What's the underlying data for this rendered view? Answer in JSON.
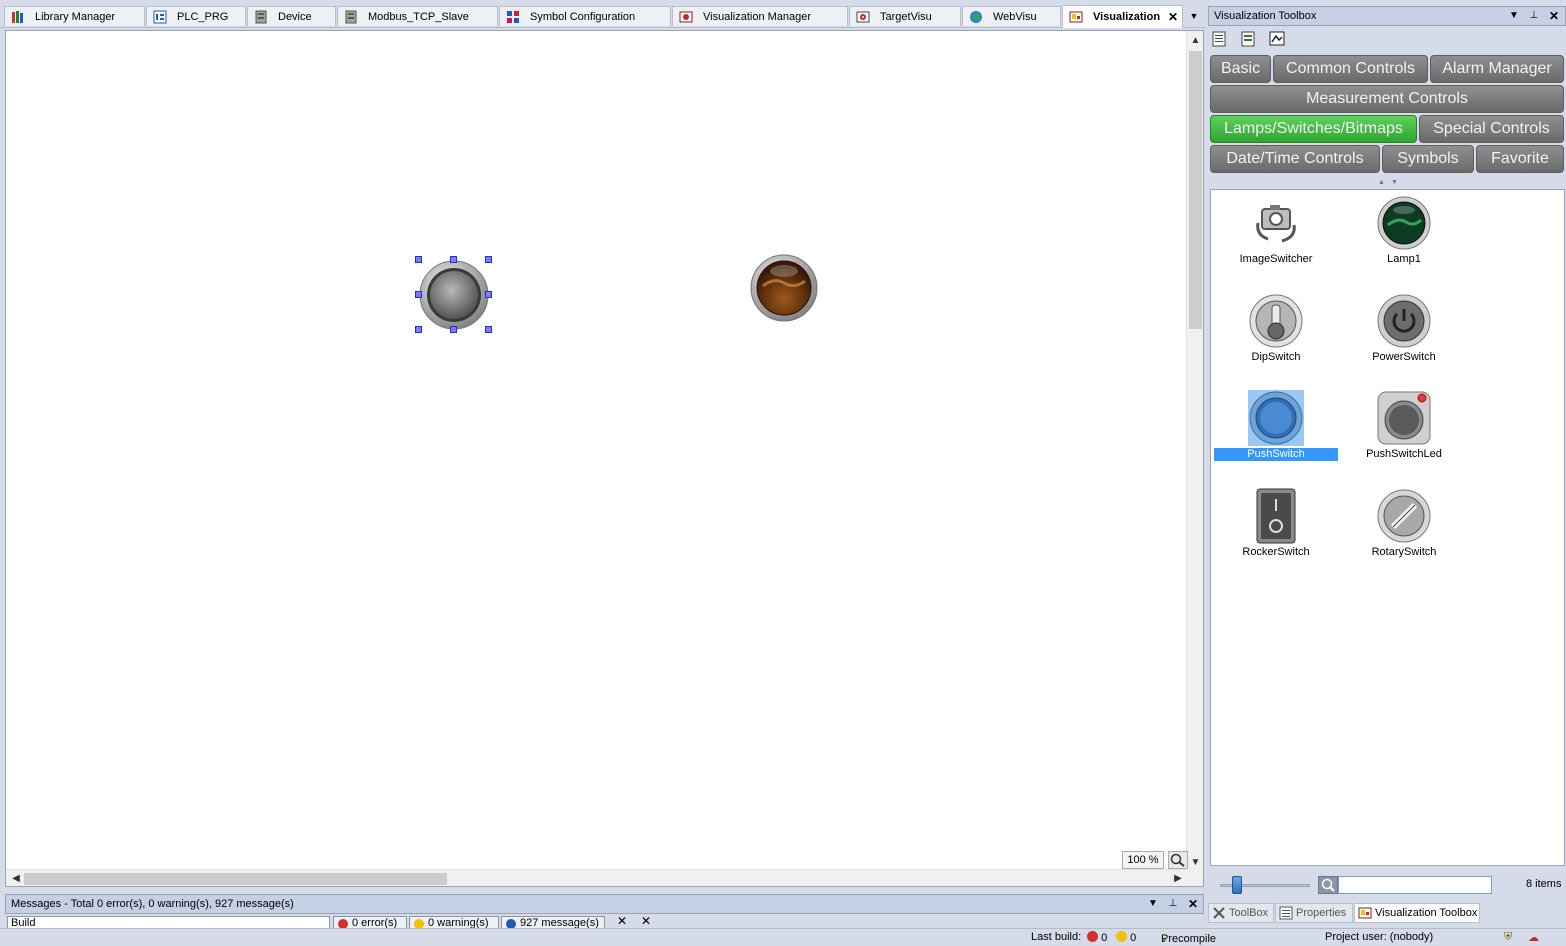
{
  "tabs": [
    {
      "label": "Library Manager",
      "icon": "books-icon"
    },
    {
      "label": "PLC_PRG",
      "icon": "program-icon"
    },
    {
      "label": "Device",
      "icon": "device-icon"
    },
    {
      "label": "Modbus_TCP_Slave",
      "icon": "device-icon"
    },
    {
      "label": "Symbol Configuration",
      "icon": "symbol-config-icon"
    },
    {
      "label": "Visualization Manager",
      "icon": "visu-manager-icon"
    },
    {
      "label": "TargetVisu",
      "icon": "target-visu-icon"
    },
    {
      "label": "WebVisu",
      "icon": "web-visu-icon"
    },
    {
      "label": "Visualization",
      "icon": "visualization-icon",
      "active": true
    }
  ],
  "editor": {
    "zoom_label": "100 %"
  },
  "messages": {
    "title": "Messages - Total 0 error(s), 0 warning(s), 927 message(s)",
    "source_value": "Build",
    "errors_label": "0 error(s)",
    "warnings_label": "0 warning(s)",
    "messages_label": "927 message(s)"
  },
  "statusbar": {
    "last_build_label": "Last build:",
    "errors": "0",
    "warnings": "0",
    "precompile_label": "Precompile",
    "project_user": "Project user: (nobody)"
  },
  "toolbox": {
    "title": "Visualization Toolbox",
    "categories": [
      {
        "label": "Basic",
        "active": false
      },
      {
        "label": "Common Controls",
        "active": false
      },
      {
        "label": "Alarm Manager",
        "active": false
      },
      {
        "label": "Measurement Controls",
        "active": false
      },
      {
        "label": "Lamps/Switches/Bitmaps",
        "active": true
      },
      {
        "label": "Special Controls",
        "active": false
      },
      {
        "label": "Date/Time Controls",
        "active": false
      },
      {
        "label": "Symbols",
        "active": false
      },
      {
        "label": "Favorite",
        "active": false
      }
    ],
    "items": [
      {
        "label": "ImageSwitcher",
        "icon": "image-switcher-icon"
      },
      {
        "label": "Lamp1",
        "icon": "lamp-icon"
      },
      {
        "label": "DipSwitch",
        "icon": "dip-switch-icon"
      },
      {
        "label": "PowerSwitch",
        "icon": "power-switch-icon"
      },
      {
        "label": "PushSwitch",
        "icon": "push-switch-icon",
        "selected": true
      },
      {
        "label": "PushSwitchLed",
        "icon": "push-switch-led-icon"
      },
      {
        "label": "RockerSwitch",
        "icon": "rocker-switch-icon"
      },
      {
        "label": "RotarySwitch",
        "icon": "rotary-switch-icon"
      }
    ],
    "search_placeholder": "",
    "item_count": "8 items",
    "bottom_tabs": [
      {
        "label": "ToolBox",
        "icon": "tools-icon",
        "active": false
      },
      {
        "label": "Properties",
        "icon": "properties-icon",
        "active": false
      },
      {
        "label": "Visualization Toolbox",
        "icon": "visualization-icon",
        "active": true
      }
    ]
  },
  "colors": {
    "accent_green": "#2fa52f",
    "selection_blue": "#3399ff",
    "panel_bg": "#d6dbe9"
  }
}
